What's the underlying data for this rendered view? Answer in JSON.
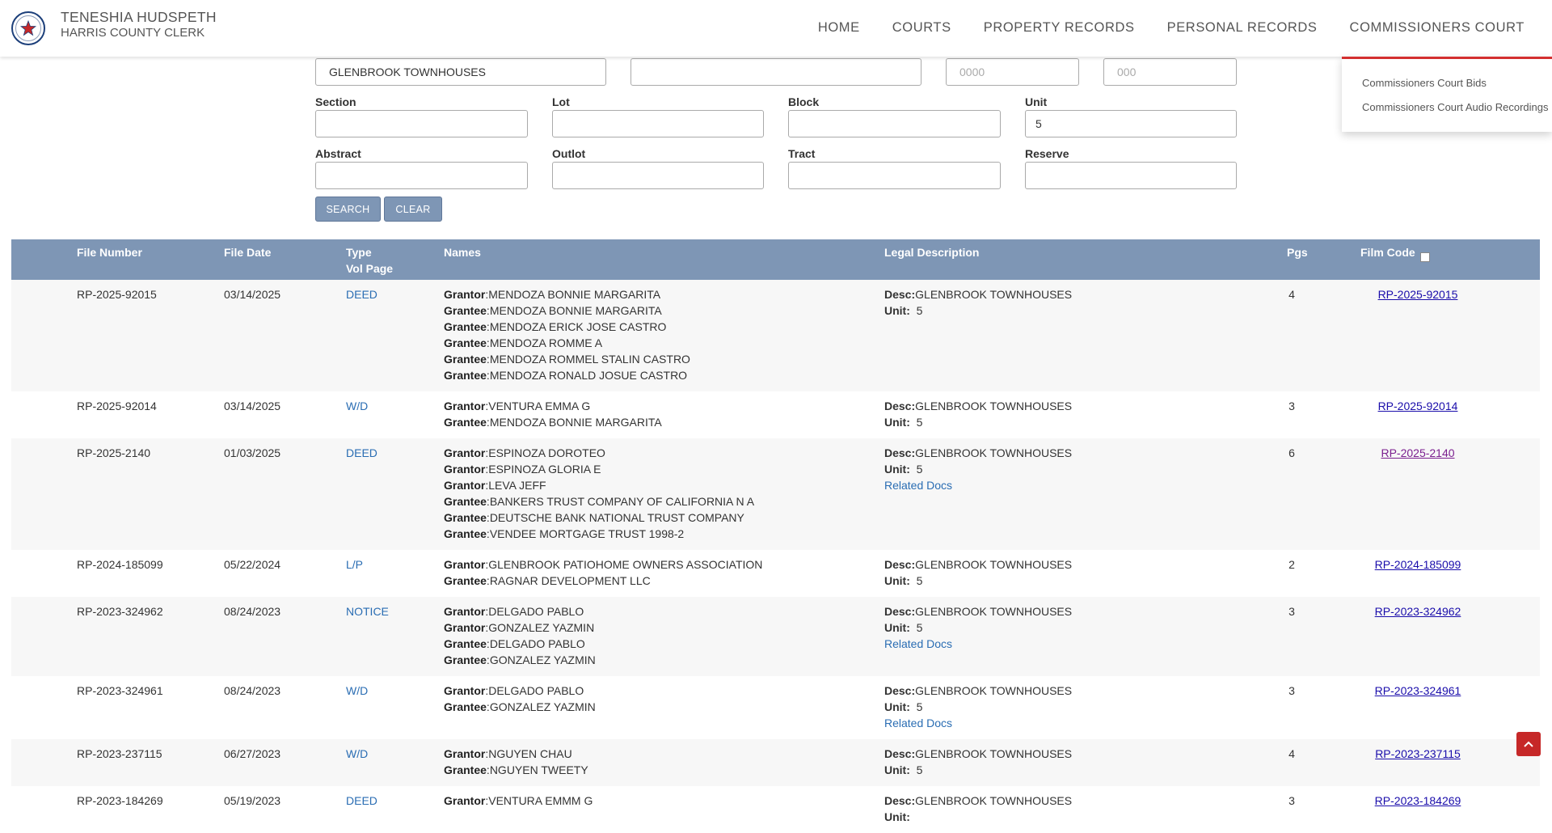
{
  "header": {
    "org_name": "TENESHIA HUDSPETH",
    "org_sub": "HARRIS COUNTY CLERK",
    "nav": [
      "HOME",
      "COURTS",
      "PROPERTY RECORDS",
      "PERSONAL RECORDS",
      "COMMISSIONERS COURT"
    ]
  },
  "dropdown": {
    "items": [
      "Commissioners Court Bids",
      "Commissioners Court Audio Recordings"
    ]
  },
  "form": {
    "subdivision_value": "GLENBROOK TOWNHOUSES",
    "field2_value": "",
    "field3_placeholder": "0000",
    "field4_placeholder": "000",
    "section_label": "Section",
    "lot_label": "Lot",
    "block_label": "Block",
    "unit_label": "Unit",
    "unit_value": "5",
    "abstract_label": "Abstract",
    "outlot_label": "Outlot",
    "tract_label": "Tract",
    "reserve_label": "Reserve",
    "search_label": "SEARCH",
    "clear_label": "CLEAR"
  },
  "table": {
    "headers": {
      "file_number": "File Number",
      "file_date": "File Date",
      "type": "Type",
      "vol_page": "Vol Page",
      "names": "Names",
      "legal": "Legal Description",
      "pgs": "Pgs",
      "film_code": "Film Code"
    },
    "labels": {
      "desc": "Desc:",
      "unit": "Unit:",
      "related": "Related Docs"
    },
    "rows": [
      {
        "file_number": "RP-2025-92015",
        "file_date": "03/14/2025",
        "type": "DEED",
        "names": [
          [
            "Grantor",
            "MENDOZA BONNIE MARGARITA"
          ],
          [
            "Grantee",
            "MENDOZA BONNIE MARGARITA"
          ],
          [
            "Grantee",
            "MENDOZA ERICK JOSE CASTRO"
          ],
          [
            "Grantee",
            "MENDOZA ROMME A"
          ],
          [
            "Grantee",
            "MENDOZA ROMMEL STALIN CASTRO"
          ],
          [
            "Grantee",
            "MENDOZA RONALD JOSUE CASTRO"
          ]
        ],
        "desc": "GLENBROOK TOWNHOUSES",
        "unit": "5",
        "related": false,
        "pgs": "4",
        "film_code": "RP-2025-92015",
        "visited": false
      },
      {
        "file_number": "RP-2025-92014",
        "file_date": "03/14/2025",
        "type": "W/D",
        "names": [
          [
            "Grantor",
            "VENTURA EMMA G"
          ],
          [
            "Grantee",
            "MENDOZA BONNIE MARGARITA"
          ]
        ],
        "desc": "GLENBROOK TOWNHOUSES",
        "unit": "5",
        "related": false,
        "pgs": "3",
        "film_code": "RP-2025-92014",
        "visited": false
      },
      {
        "file_number": "RP-2025-2140",
        "file_date": "01/03/2025",
        "type": "DEED",
        "names": [
          [
            "Grantor",
            "ESPINOZA DOROTEO"
          ],
          [
            "Grantor",
            "ESPINOZA GLORIA E"
          ],
          [
            "Grantor",
            "LEVA JEFF"
          ],
          [
            "Grantee",
            "BANKERS TRUST COMPANY OF CALIFORNIA N A"
          ],
          [
            "Grantee",
            "DEUTSCHE BANK NATIONAL TRUST COMPANY"
          ],
          [
            "Grantee",
            "VENDEE MORTGAGE TRUST 1998-2"
          ]
        ],
        "desc": "GLENBROOK TOWNHOUSES",
        "unit": "5",
        "related": true,
        "pgs": "6",
        "film_code": "RP-2025-2140",
        "visited": true
      },
      {
        "file_number": "RP-2024-185099",
        "file_date": "05/22/2024",
        "type": "L/P",
        "names": [
          [
            "Grantor",
            "GLENBROOK PATIOHOME OWNERS ASSOCIATION"
          ],
          [
            "Grantee",
            "RAGNAR DEVELOPMENT LLC"
          ]
        ],
        "desc": "GLENBROOK TOWNHOUSES",
        "unit": "5",
        "related": false,
        "pgs": "2",
        "film_code": "RP-2024-185099",
        "visited": false
      },
      {
        "file_number": "RP-2023-324962",
        "file_date": "08/24/2023",
        "type": "NOTICE",
        "names": [
          [
            "Grantor",
            "DELGADO PABLO"
          ],
          [
            "Grantor",
            "GONZALEZ YAZMIN"
          ],
          [
            "Grantee",
            "DELGADO PABLO"
          ],
          [
            "Grantee",
            "GONZALEZ YAZMIN"
          ]
        ],
        "desc": "GLENBROOK TOWNHOUSES",
        "unit": "5",
        "related": true,
        "pgs": "3",
        "film_code": "RP-2023-324962",
        "visited": false
      },
      {
        "file_number": "RP-2023-324961",
        "file_date": "08/24/2023",
        "type": "W/D",
        "names": [
          [
            "Grantor",
            "DELGADO PABLO"
          ],
          [
            "Grantee",
            "GONZALEZ YAZMIN"
          ]
        ],
        "desc": "GLENBROOK TOWNHOUSES",
        "unit": "5",
        "related": true,
        "pgs": "3",
        "film_code": "RP-2023-324961",
        "visited": false
      },
      {
        "file_number": "RP-2023-237115",
        "file_date": "06/27/2023",
        "type": "W/D",
        "names": [
          [
            "Grantor",
            "NGUYEN CHAU"
          ],
          [
            "Grantee",
            "NGUYEN TWEETY"
          ]
        ],
        "desc": "GLENBROOK TOWNHOUSES",
        "unit": "5",
        "related": false,
        "pgs": "4",
        "film_code": "RP-2023-237115",
        "visited": false
      },
      {
        "file_number": "RP-2023-184269",
        "file_date": "05/19/2023",
        "type": "DEED",
        "names": [
          [
            "Grantor",
            "VENTURA EMMM G"
          ]
        ],
        "desc": "GLENBROOK TOWNHOUSES",
        "unit": "",
        "related": false,
        "pgs": "3",
        "film_code": "RP-2023-184269",
        "visited": false
      }
    ]
  }
}
